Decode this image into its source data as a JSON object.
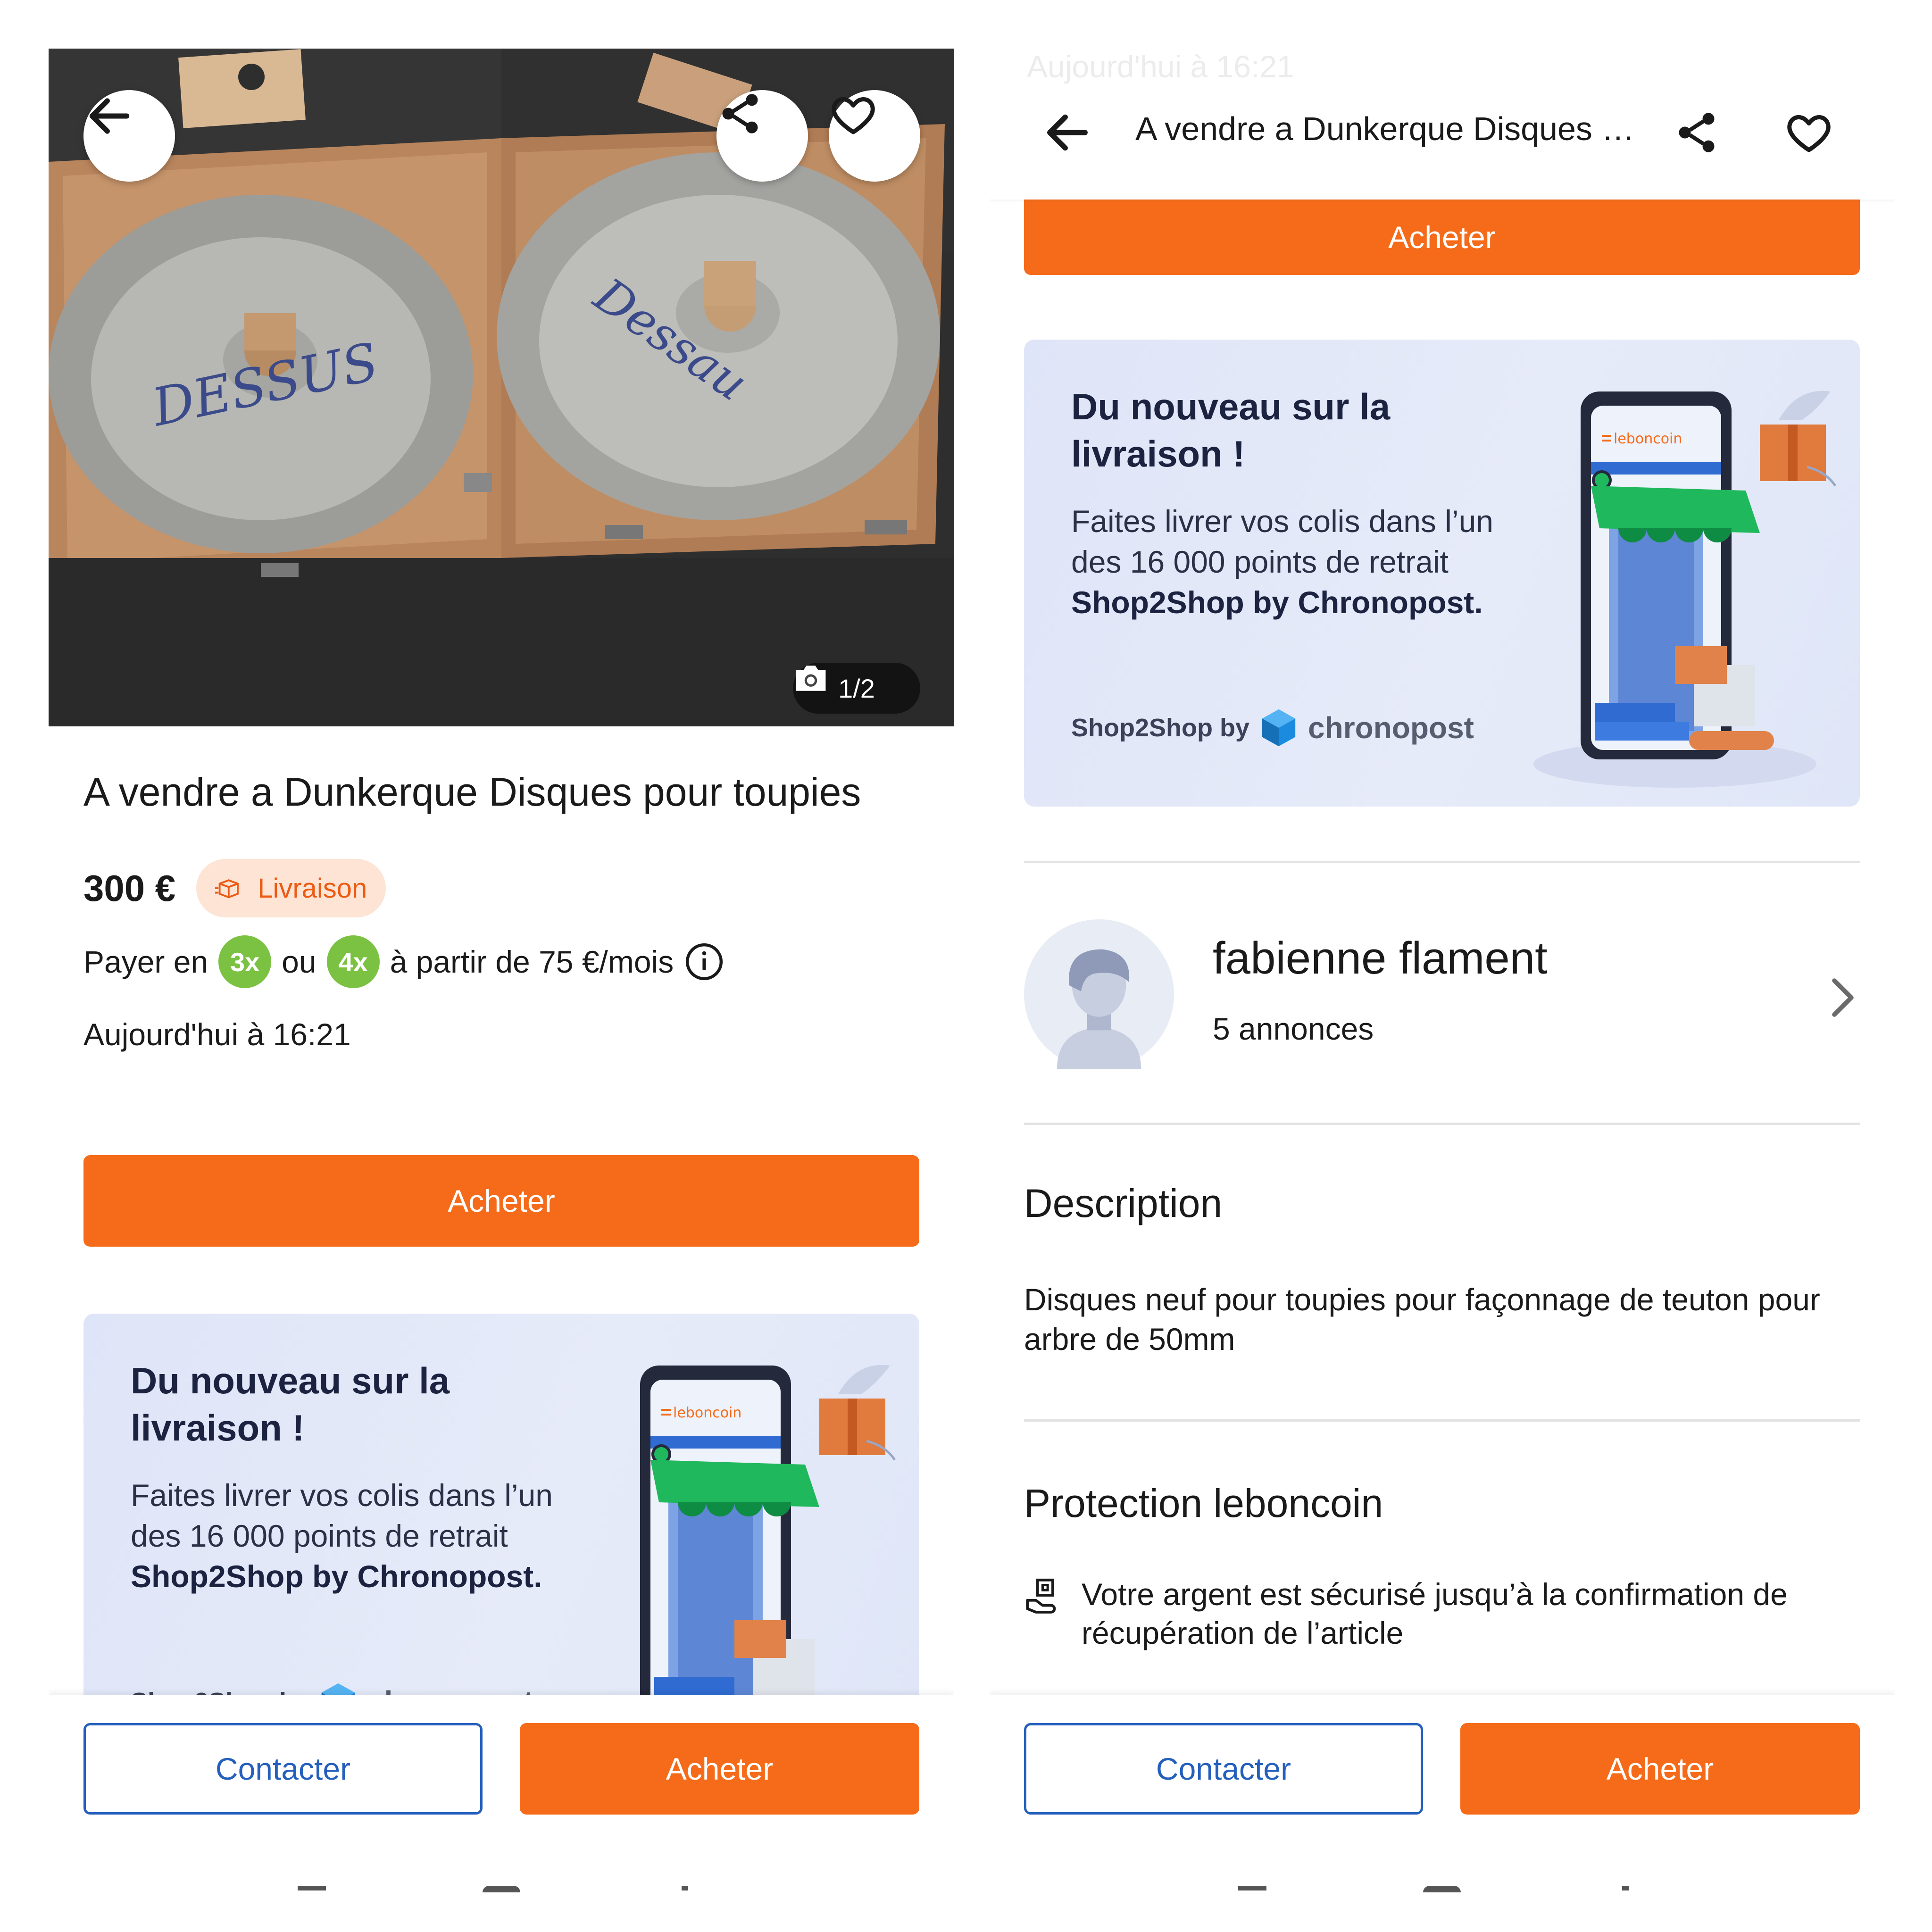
{
  "left": {
    "photo": {
      "counter": "1/2",
      "marker_text_1": "DESSUS",
      "marker_text_2": "Dessau"
    },
    "title": "A vendre a Dunkerque Disques pour toupies",
    "price": "300 €",
    "shipping_badge": "Livraison",
    "pay": {
      "prefix": "Payer en",
      "opt1": "3x",
      "or": "ou",
      "opt2": "4x",
      "suffix": "à partir de 75 €/mois"
    },
    "date": "Aujourd'hui à 16:21",
    "buy_button": "Acheter"
  },
  "promo": {
    "title": "Du nouveau sur la livraison !",
    "text_part1": "Faites livrer vos colis dans l’un des 16 000 points de retrait ",
    "text_bold": "Shop2Shop by Chronopost.",
    "brand_small": "Shop2Shop by",
    "brand_name": "chronopost",
    "app_label": "leboncoin"
  },
  "right": {
    "topbar_ghost": "Aujourd'hui à 16:21",
    "topbar_title": "A vendre a Dunkerque Disques p...",
    "buy_button": "Acheter",
    "seller": {
      "name": "fabienne flament",
      "count": "5 annonces"
    },
    "description": {
      "heading": "Description",
      "text": "Disques neuf pour toupies pour façonnage de teuton pour arbre de 50mm"
    },
    "protection": {
      "heading": "Protection leboncoin",
      "line1": "Votre argent est sécurisé jusqu’à la confirmation de récupération de l’article"
    }
  },
  "bottom": {
    "contact": "Contacter",
    "buy": "Acheter"
  },
  "colors": {
    "accent_orange": "#f56b1a",
    "link_blue": "#255fbd",
    "green_pill": "#7bc242"
  }
}
